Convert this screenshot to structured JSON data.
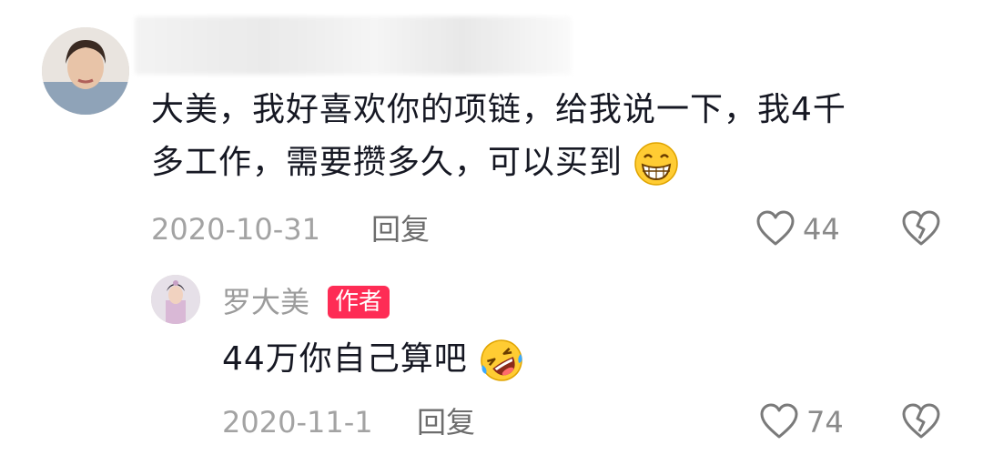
{
  "comment": {
    "text_line1": "大美，我好喜欢你的项链，给我说一下，我4千",
    "text_line2": "多工作，需要攒多久，可以买到",
    "emoji": "grinning-face",
    "date": "2020-10-31",
    "reply_label": "回复",
    "like_count": "44"
  },
  "reply": {
    "author": "罗大美",
    "badge": "作者",
    "text": "44万你自己算吧",
    "emoji": "rolling-on-floor-laughing",
    "date": "2020-11-1",
    "reply_label": "回复",
    "like_count": "74"
  },
  "colors": {
    "badge": "#fe2c55",
    "text": "#161823",
    "meta": "#a3a3a3"
  }
}
